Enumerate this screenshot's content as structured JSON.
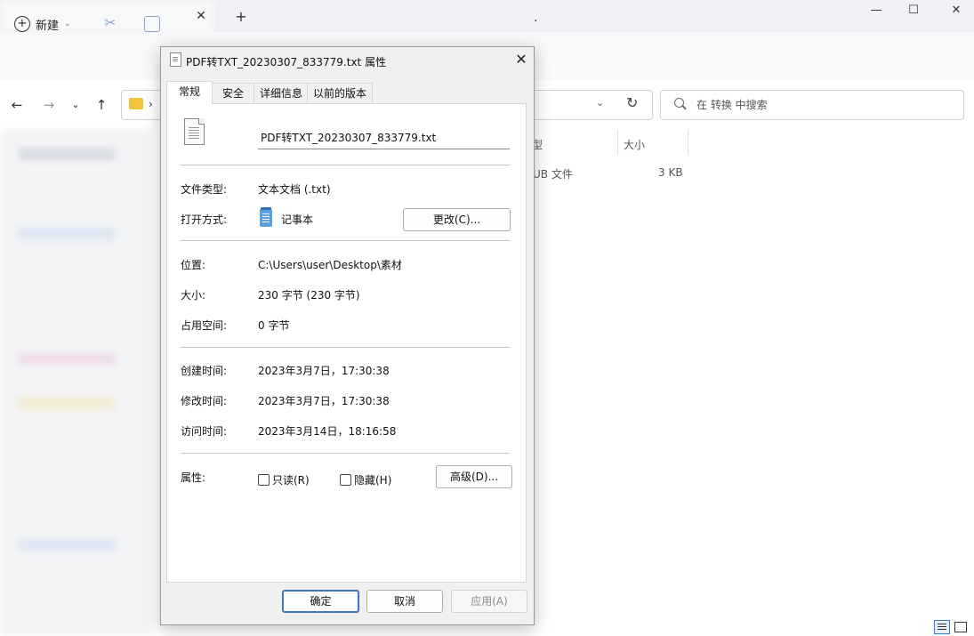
{
  "explorer": {
    "new_label": "新建",
    "search_placeholder": "在 转换 中搜索",
    "col_size": "大小",
    "col_type_partial": "型",
    "row_type_partial": "UB 文件",
    "row_size": "3 KB"
  },
  "dialog": {
    "title": "PDF转TXT_20230307_833779.txt 属性",
    "tabs": [
      "常规",
      "安全",
      "详细信息",
      "以前的版本"
    ],
    "filename": "PDF转TXT_20230307_833779.txt",
    "type_label": "文件类型:",
    "type_value": "文本文档 (.txt)",
    "open_label": "打开方式:",
    "open_value": "记事本",
    "change_button": "更改(C)...",
    "location_label": "位置:",
    "location_value": "C:\\Users\\user\\Desktop\\素材",
    "size_label": "大小:",
    "size_value": "230 字节 (230 字节)",
    "disk_label": "占用空间:",
    "disk_value": "0 字节",
    "created_label": "创建时间:",
    "created_value": "2023年3月7日，17:30:38",
    "modified_label": "修改时间:",
    "modified_value": "2023年3月7日，17:30:38",
    "accessed_label": "访问时间:",
    "accessed_value": "2023年3月14日，18:16:58",
    "attr_label": "属性:",
    "readonly_label": "只读(R)",
    "hidden_label": "隐藏(H)",
    "advanced_button": "高级(D)...",
    "ok_button": "确定",
    "cancel_button": "取消",
    "apply_button": "应用(A)"
  }
}
